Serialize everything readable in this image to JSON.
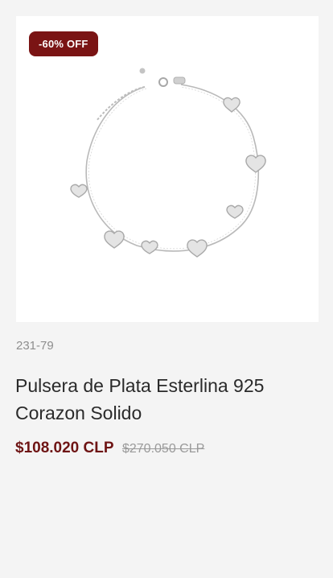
{
  "product": {
    "badge": "-60% OFF",
    "sku": "231-79",
    "title": "Pulsera de Plata Esterlina 925 Corazon Solido",
    "price_sale": "$108.020 CLP",
    "price_original": "$270.050 CLP",
    "image_icon": "heart-charm-bracelet"
  },
  "colors": {
    "badge_bg": "#7a1414",
    "sale_price": "#6e1414",
    "old_price": "#9a9a9a"
  }
}
